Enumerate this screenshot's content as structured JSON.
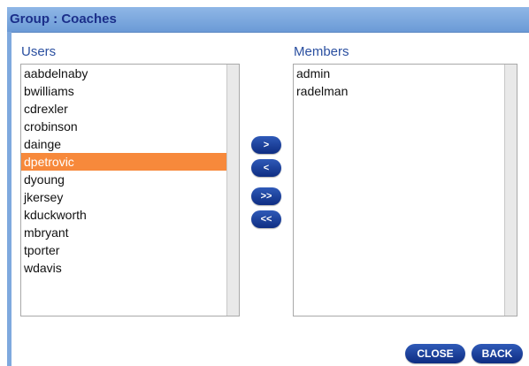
{
  "dialog": {
    "title": "Group : Coaches"
  },
  "users": {
    "label": "Users",
    "items": [
      {
        "name": "aabdelnaby",
        "selected": false
      },
      {
        "name": "bwilliams",
        "selected": false
      },
      {
        "name": "cdrexler",
        "selected": false
      },
      {
        "name": "crobinson",
        "selected": false
      },
      {
        "name": "dainge",
        "selected": false
      },
      {
        "name": "dpetrovic",
        "selected": true
      },
      {
        "name": "dyoung",
        "selected": false
      },
      {
        "name": "jkersey",
        "selected": false
      },
      {
        "name": "kduckworth",
        "selected": false
      },
      {
        "name": "mbryant",
        "selected": false
      },
      {
        "name": "tporter",
        "selected": false
      },
      {
        "name": "wdavis",
        "selected": false
      }
    ]
  },
  "members": {
    "label": "Members",
    "items": [
      {
        "name": "admin",
        "selected": false
      },
      {
        "name": "radelman",
        "selected": false
      }
    ]
  },
  "transfer": {
    "add": ">",
    "remove": "<",
    "add_all": ">>",
    "remove_all": "<<"
  },
  "actions": {
    "close": "CLOSE",
    "back": "BACK"
  },
  "colors": {
    "header": "#7ea7dc",
    "title_text": "#1b2f8a",
    "selection": "#f7893b",
    "button": "#1a3c95"
  }
}
